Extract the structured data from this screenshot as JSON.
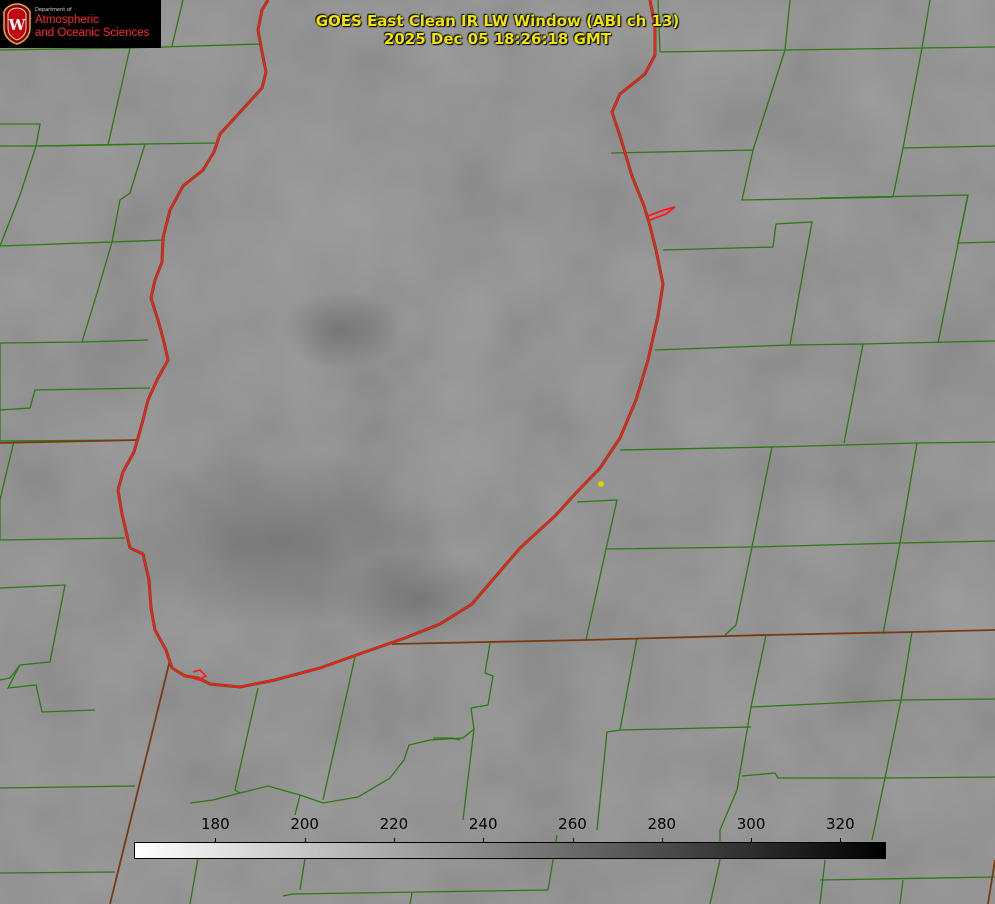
{
  "title": {
    "line1": "GOES East Clean IR LW Window (ABI ch 13)",
    "line2": "2025 Dec 05 18:26:18 GMT"
  },
  "logo": {
    "line_small": "Department of",
    "line1": "Atmospheric",
    "line2": "and Oceanic Sciences",
    "crest_letter": "W",
    "icon": "university-crest-icon"
  },
  "colorbar": {
    "min": 162,
    "max": 330,
    "ticks": [
      "180",
      "200",
      "220",
      "240",
      "260",
      "280",
      "300",
      "320"
    ],
    "start_color": "#ffffff",
    "end_color": "#000000"
  },
  "colors": {
    "lake_shoreline": "#ff1a1a",
    "county_borders": "#2a7a10",
    "state_border": "#7a3a10",
    "station_marker": "#e0d000",
    "title_text": "#f2e600"
  },
  "map": {
    "features": [
      "lake-michigan-shoreline",
      "county-borders",
      "state-border",
      "station-marker"
    ]
  }
}
